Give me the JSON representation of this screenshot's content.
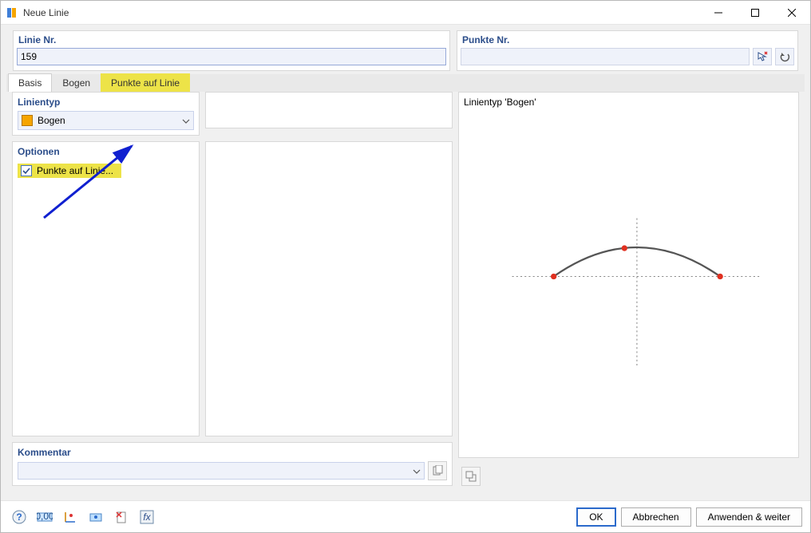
{
  "window": {
    "title": "Neue Linie"
  },
  "left_panel": {
    "heading": "Linie Nr.",
    "value": "159"
  },
  "right_panel": {
    "heading": "Punkte Nr.",
    "value": ""
  },
  "tabs": {
    "basis": "Basis",
    "bogen": "Bogen",
    "punkte": "Punkte auf Linie"
  },
  "linientyp": {
    "heading": "Linientyp",
    "value": "Bogen"
  },
  "optionen": {
    "heading": "Optionen",
    "check_label": "Punkte auf Linie..."
  },
  "kommentar": {
    "heading": "Kommentar"
  },
  "preview": {
    "heading": "Linientyp 'Bogen'"
  },
  "buttons": {
    "ok": "OK",
    "cancel": "Abbrechen",
    "apply": "Anwenden & weiter"
  }
}
